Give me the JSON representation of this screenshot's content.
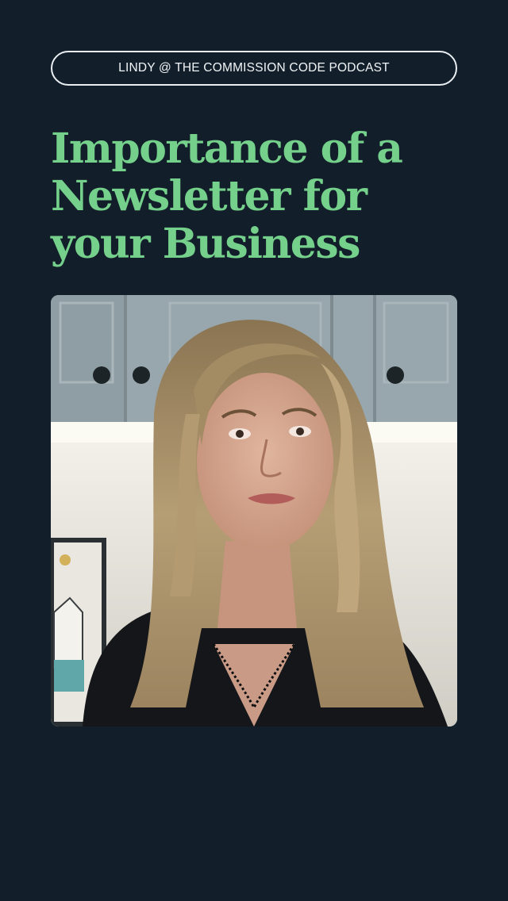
{
  "header": {
    "pill_label": "LINDY @ THE COMMISSION CODE PODCAST"
  },
  "headline": {
    "lines": [
      "Importance of a",
      "Newsletter for",
      "your Business"
    ]
  },
  "colors": {
    "background": "#121f2b",
    "accent_green": "#74d08a",
    "pill_border": "#e9eef2"
  },
  "video": {
    "subject": "woman-speaking-on-camera"
  }
}
